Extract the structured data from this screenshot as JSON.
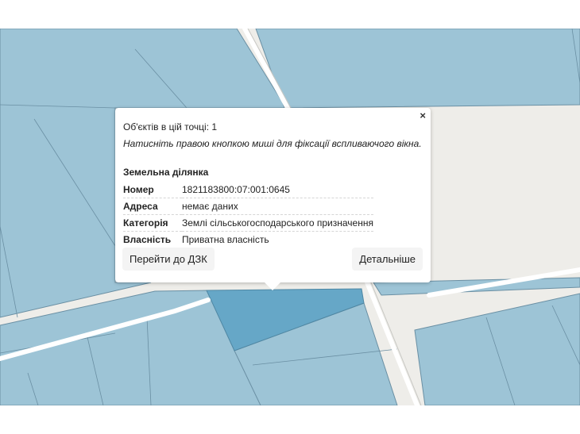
{
  "map": {
    "colors": {
      "background": "#eeede9",
      "parcel": "#9dc4d6",
      "parcel_border": "#6a8fa3",
      "selected_parcel": "#66a7c7",
      "road": "#ffffff"
    }
  },
  "popup": {
    "close_label": "×",
    "objects_count_text": "Об'єктів в цій точці: 1",
    "hint_text": "Натисніть правою кнопкою миші для фіксації вспливаючого вікна.",
    "section_title": "Земельна ділянка",
    "rows": [
      {
        "key": "Номер",
        "value": "1821183800:07:001:0645"
      },
      {
        "key": "Адреса",
        "value": "немає даних"
      },
      {
        "key": "Категорія",
        "value": "Землі сільськогосподарського призначення"
      },
      {
        "key": "Власність",
        "value": "Приватна власність"
      }
    ],
    "buttons": {
      "goto_dzk": "Перейти до ДЗК",
      "details": "Детальніше"
    }
  }
}
